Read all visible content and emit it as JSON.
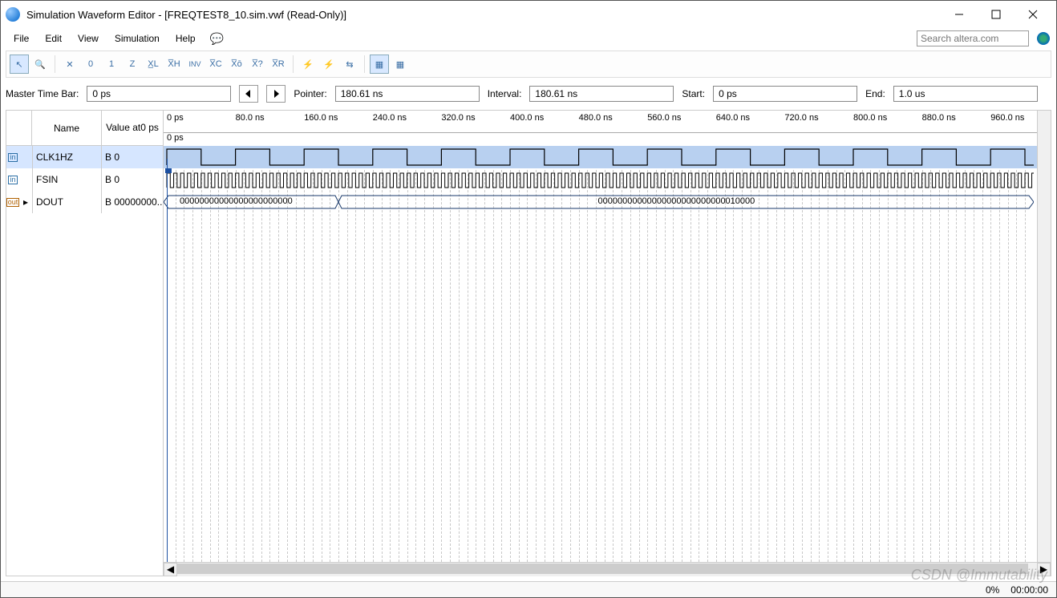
{
  "window": {
    "title": "Simulation Waveform Editor - [FREQTEST8_10.sim.vwf (Read-Only)]"
  },
  "menu": {
    "items": [
      "File",
      "Edit",
      "View",
      "Simulation",
      "Help"
    ]
  },
  "search": {
    "placeholder": "Search altera.com"
  },
  "toolbar": {
    "icons": [
      "pointer",
      "zoom",
      "xx",
      "0",
      "1",
      "z",
      "xl",
      "xh",
      "inv",
      "xc",
      "xo",
      "xq",
      "xr",
      "rand1",
      "rand2",
      "snap",
      "grid",
      "eq",
      "eq2"
    ]
  },
  "infobar": {
    "master_label": "Master Time Bar:",
    "master_value": "0 ps",
    "pointer_label": "Pointer:",
    "pointer_value": "180.61 ns",
    "interval_label": "Interval:",
    "interval_value": "180.61 ns",
    "start_label": "Start:",
    "start_value": "0 ps",
    "end_label": "End:",
    "end_value": "1.0 us"
  },
  "signals": {
    "head_name": "Name",
    "head_value_line1": "Value at",
    "head_value_line2": "0 ps",
    "rows": [
      {
        "dir": "in",
        "name": "CLK1HZ",
        "value": "B 0",
        "selected": true
      },
      {
        "dir": "in",
        "name": "FSIN",
        "value": "B 0"
      },
      {
        "dir": "out",
        "name": "DOUT",
        "value": "B 00000000...",
        "expandable": true
      }
    ]
  },
  "ruler": {
    "ticks": [
      {
        "pos": 0,
        "label": "0 ps"
      },
      {
        "pos": 80,
        "label": "80.0 ns"
      },
      {
        "pos": 160,
        "label": "160.0 ns"
      },
      {
        "pos": 240,
        "label": "240.0 ns"
      },
      {
        "pos": 320,
        "label": "320.0 ns"
      },
      {
        "pos": 400,
        "label": "400.0 ns"
      },
      {
        "pos": 480,
        "label": "480.0 ns"
      },
      {
        "pos": 560,
        "label": "560.0 ns"
      },
      {
        "pos": 640,
        "label": "640.0 ns"
      },
      {
        "pos": 720,
        "label": "720.0 ns"
      },
      {
        "pos": 800,
        "label": "800.0 ns"
      },
      {
        "pos": 880,
        "label": "880.0 ns"
      },
      {
        "pos": 960,
        "label": "960.0 ns"
      }
    ],
    "marker_label": "0 ps"
  },
  "waveform": {
    "clk1hz_period_ns": 80,
    "fsin_period_ns": 8,
    "dout_seg1": "00000000000000000000000",
    "dout_seg2": "00000000000000000000000000010000",
    "dout_transition_ns": 200
  },
  "status": {
    "progress": "0%",
    "time": "00:00:00"
  },
  "watermark": "CSDN @Immutability"
}
